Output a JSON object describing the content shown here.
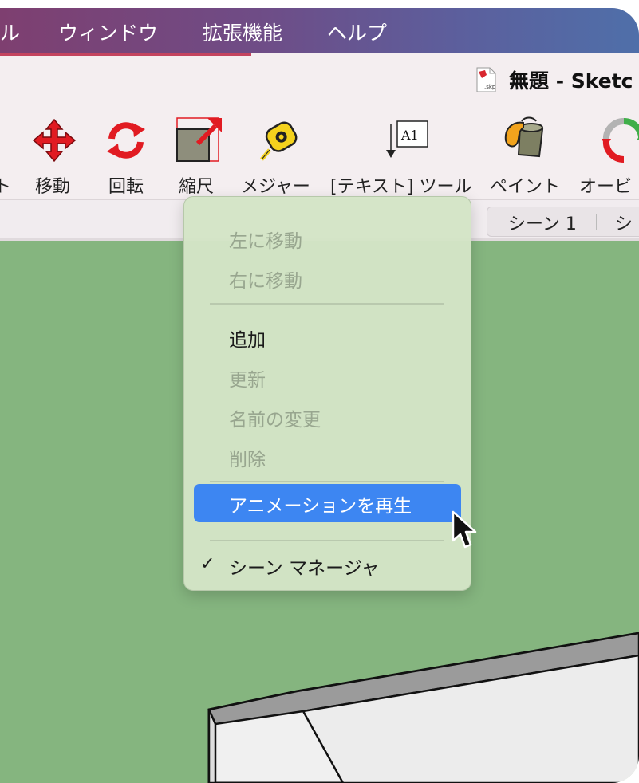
{
  "menubar": {
    "items": [
      "ル",
      "ウィンドウ",
      "拡張機能",
      "ヘルプ"
    ]
  },
  "window": {
    "title": "無題 - Sketc",
    "file_badge": ".skp"
  },
  "toolbar": {
    "tools": [
      {
        "icon": "move-icon",
        "label": "移動"
      },
      {
        "icon": "rotate-icon",
        "label": "回転"
      },
      {
        "icon": "scale-icon",
        "label": "縮尺"
      },
      {
        "icon": "tape-measure-icon",
        "label": "メジャー"
      },
      {
        "icon": "text-tool-icon",
        "label": "[テキスト] ツール",
        "icon_text": "A1"
      },
      {
        "icon": "paint-bucket-icon",
        "label": "ペイント"
      },
      {
        "icon": "orbit-icon",
        "label": "オービ"
      }
    ],
    "partial_left_label": "ト"
  },
  "scene_tabs": [
    "シーン 1",
    "シ"
  ],
  "context_menu": {
    "items": [
      {
        "label": "左に移動",
        "enabled": false
      },
      {
        "label": "右に移動",
        "enabled": false
      },
      {
        "label": "追加",
        "enabled": true
      },
      {
        "label": "更新",
        "enabled": false
      },
      {
        "label": "名前の変更",
        "enabled": false
      },
      {
        "label": "削除",
        "enabled": false
      },
      {
        "label": "アニメーションを再生",
        "enabled": true,
        "highlighted": true
      },
      {
        "label": "シーン マネージャ",
        "enabled": true,
        "checked": true
      }
    ],
    "check_mark": "✓"
  },
  "colors": {
    "menubar_start": "#7e3f70",
    "menubar_end": "#4f6fa9",
    "viewport": "#85b57f",
    "menu_background": "#d4e4c6",
    "highlight": "#3d86f2"
  }
}
